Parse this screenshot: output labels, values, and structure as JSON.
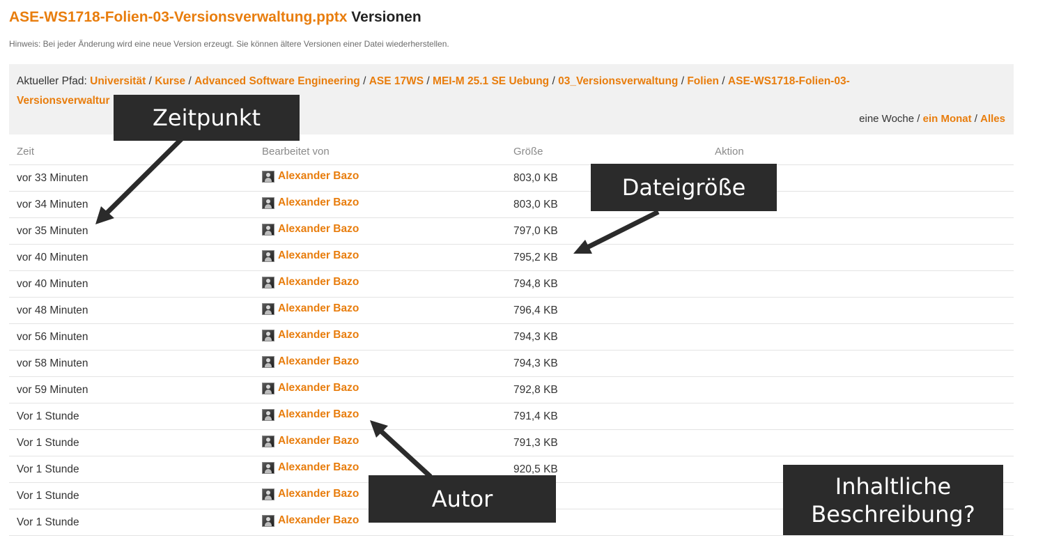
{
  "header": {
    "file_name": "ASE-WS1718-Folien-03-Versionsverwaltung.pptx",
    "suffix": "Versionen",
    "hint": "Hinweis: Bei jeder Änderung wird eine neue Version erzeugt. Sie können ältere Versionen einer Datei wiederherstellen."
  },
  "path": {
    "label": "Aktueller Pfad:",
    "crumbs": [
      "Universität",
      "Kurse",
      "Advanced Software Engineering",
      "ASE 17WS",
      "MEI-M 25.1 SE Uebung",
      "03_Versionsverwaltung",
      "Folien",
      "ASE-WS1718-Folien-03-",
      "Versionsverwaltung.pptx"
    ],
    "line2_visible": "Versionsverwaltur"
  },
  "filter": {
    "week": "eine Woche",
    "month": "ein Monat",
    "all": "Alles"
  },
  "table": {
    "headers": {
      "time": "Zeit",
      "author": "Bearbeitet von",
      "size": "Größe",
      "action": "Aktion"
    },
    "rows": [
      {
        "time": "vor 33 Minuten",
        "author": "Alexander Bazo",
        "size": "803,0 KB"
      },
      {
        "time": "vor 34 Minuten",
        "author": "Alexander Bazo",
        "size": "803,0 KB"
      },
      {
        "time": "vor 35 Minuten",
        "author": "Alexander Bazo",
        "size": "797,0 KB"
      },
      {
        "time": "vor 40 Minuten",
        "author": "Alexander Bazo",
        "size": "795,2 KB"
      },
      {
        "time": "vor 40 Minuten",
        "author": "Alexander Bazo",
        "size": "794,8 KB"
      },
      {
        "time": "vor 48 Minuten",
        "author": "Alexander Bazo",
        "size": "796,4 KB"
      },
      {
        "time": "vor 56 Minuten",
        "author": "Alexander Bazo",
        "size": "794,3 KB"
      },
      {
        "time": "vor 58 Minuten",
        "author": "Alexander Bazo",
        "size": "794,3 KB"
      },
      {
        "time": "vor 59 Minuten",
        "author": "Alexander Bazo",
        "size": "792,8 KB"
      },
      {
        "time": "Vor 1 Stunde",
        "author": "Alexander Bazo",
        "size": "791,4 KB"
      },
      {
        "time": "Vor 1 Stunde",
        "author": "Alexander Bazo",
        "size": "791,3 KB"
      },
      {
        "time": "Vor 1 Stunde",
        "author": "Alexander Bazo",
        "size": "920,5 KB"
      },
      {
        "time": "Vor 1 Stunde",
        "author": "Alexander Bazo",
        "size": ""
      },
      {
        "time": "Vor 1 Stunde",
        "author": "Alexander Bazo",
        "size": ""
      }
    ]
  },
  "annotations": {
    "zeitpunkt": "Zeitpunkt",
    "dateigroesse": "Dateigröße",
    "autor": "Autor",
    "beschreibung": "Inhaltliche\nBeschreibung?"
  },
  "colors": {
    "accent": "#e87d0d",
    "callout_bg": "#2b2b2b",
    "path_bg": "#f1f1f1"
  }
}
